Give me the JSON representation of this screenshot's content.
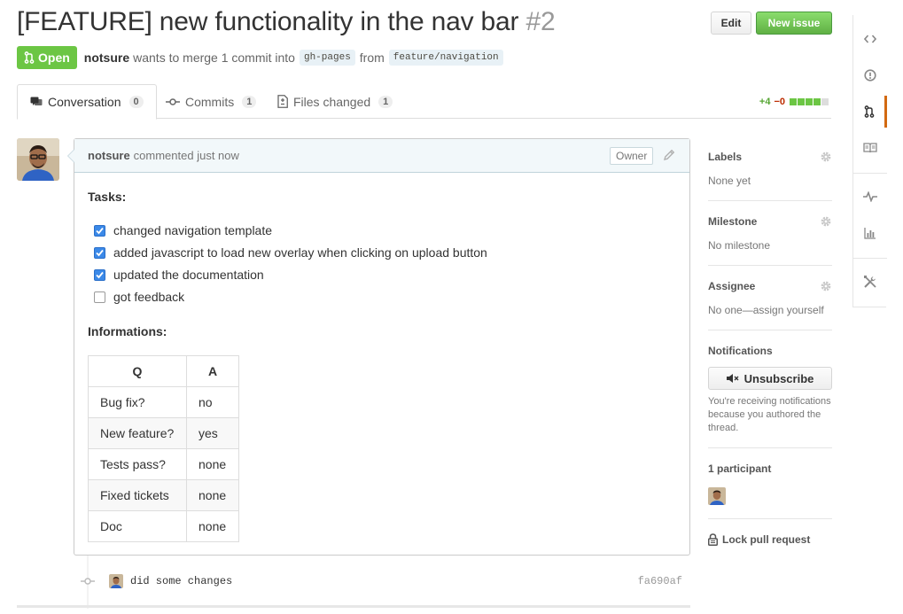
{
  "pull_request": {
    "title": "[FEATURE] new functionality in the nav bar",
    "number": "#2",
    "state": "Open",
    "author": "notsure",
    "merge_text": "wants to merge 1 commit into",
    "base_branch": "gh-pages",
    "from_text": "from",
    "head_branch": "feature/navigation"
  },
  "header_buttons": {
    "edit": "Edit",
    "new_issue": "New issue"
  },
  "tabs": [
    {
      "label": "Conversation",
      "count": "0",
      "icon": "comment-discussion-icon"
    },
    {
      "label": "Commits",
      "count": "1",
      "icon": "git-commit-icon"
    },
    {
      "label": "Files changed",
      "count": "1",
      "icon": "file-diff-icon"
    }
  ],
  "diffstat": {
    "additions": "+4",
    "deletions": "−0",
    "blocks": [
      "added",
      "added",
      "added",
      "added",
      "neutral"
    ]
  },
  "comment": {
    "author": "notsure",
    "action": "commented just now",
    "role_badge": "Owner",
    "tasks_heading": "Tasks:",
    "tasks": [
      {
        "text": "changed navigation template",
        "checked": true
      },
      {
        "text": "added javascript to load new overlay when clicking on upload button",
        "checked": true
      },
      {
        "text": "updated the documentation",
        "checked": true
      },
      {
        "text": "got feedback",
        "checked": false
      }
    ],
    "info_heading": "Informations:",
    "table": {
      "headers": [
        "Q",
        "A"
      ],
      "rows": [
        [
          "Bug fix?",
          "no"
        ],
        [
          "New feature?",
          "yes"
        ],
        [
          "Tests pass?",
          "none"
        ],
        [
          "Fixed tickets",
          "none"
        ],
        [
          "Doc",
          "none"
        ]
      ]
    }
  },
  "commit": {
    "message": "did some changes",
    "sha": "fa690af"
  },
  "sidebar": {
    "labels": {
      "title": "Labels",
      "value": "None yet"
    },
    "milestone": {
      "title": "Milestone",
      "value": "No milestone"
    },
    "assignee": {
      "title": "Assignee",
      "value": "No one—assign yourself"
    },
    "notifications": {
      "title": "Notifications",
      "button": "Unsubscribe",
      "note": "You're receiving notifications because you authored the thread."
    },
    "participants": {
      "title": "1 participant"
    },
    "lock": "Lock pull request"
  },
  "repo_nav": [
    "code-icon",
    "issue-opened-icon",
    "git-pull-request-icon",
    "book-icon",
    "pulse-icon",
    "graph-icon",
    "tools-icon"
  ],
  "colors": {
    "open_green": "#6cc644",
    "accent_orange": "#d26911",
    "addition_green": "#55a532",
    "deletion_red": "#bd2c00",
    "checkbox_blue": "#3b89e8"
  }
}
